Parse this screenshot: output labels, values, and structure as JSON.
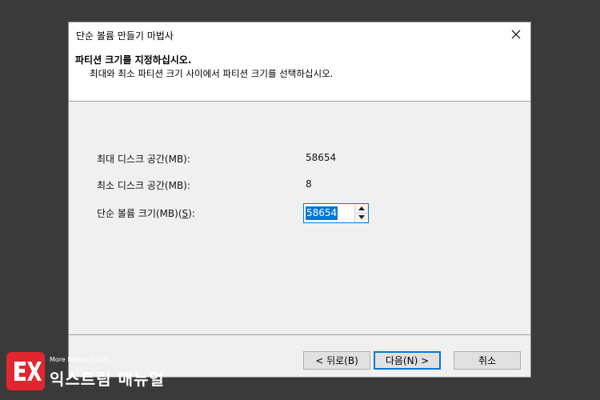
{
  "dialog": {
    "title": "단순 볼륨 만들기 마법사",
    "header_title": "파티션 크기를 지정하십시오.",
    "header_subtitle": "최대와 최소 파티션 크기 사이에서 파티션 크기를 선택하십시오."
  },
  "fields": {
    "max_label": "최대 디스크 공간(MB):",
    "max_value": "58654",
    "min_label": "최소 디스크 공간(MB):",
    "min_value": "8",
    "size_label_prefix": "단순 볼륨 크기(MB)(",
    "size_label_key": "S",
    "size_label_suffix": "):",
    "size_value": "58654"
  },
  "buttons": {
    "back": "< 뒤로(B)",
    "next": "다음(N) >",
    "cancel": "취소"
  },
  "watermark": {
    "tagline": "More Better IT Life",
    "name": "익스트림 매뉴얼"
  },
  "icons": {
    "close": "close-icon",
    "spin_up": "spin-up-icon",
    "spin_down": "spin-down-icon",
    "logo": "logo-icon"
  }
}
